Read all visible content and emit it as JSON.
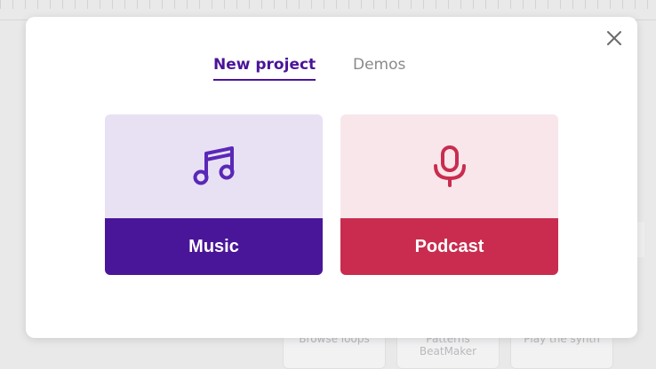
{
  "background": {
    "cards": [
      "Browse loops",
      "Patterns BeatMaker",
      "Play the synth"
    ]
  },
  "modal": {
    "close_icon": "close-icon",
    "tabs": [
      {
        "label": "New project",
        "active": true
      },
      {
        "label": "Demos",
        "active": false
      }
    ],
    "options": [
      {
        "label": "Music",
        "icon": "music-note-icon",
        "top_color": "#e8e1f4",
        "bottom_color": "#4a1699"
      },
      {
        "label": "Podcast",
        "icon": "microphone-icon",
        "top_color": "#f8e6ea",
        "bottom_color": "#c92c4f"
      }
    ]
  }
}
